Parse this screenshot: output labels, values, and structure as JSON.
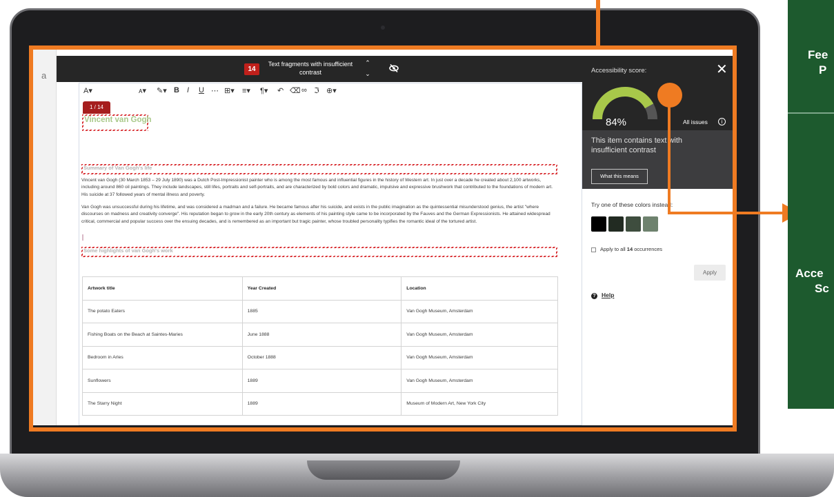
{
  "issue_bar": {
    "count": "14",
    "title": "Text fragments with insufficient contrast"
  },
  "editor": {
    "occurrence_tag": "1 / 14",
    "heading1": "Vincent van Gogh",
    "heading2": "Summary of Van Gogh's life",
    "para1": "Vincent van Gogh (30 March 1853 – 29 July 1890) was a Dutch Post-Impressionist painter who is among the most famous and influential figures in the history of Western art. In just over a decade he created about 2,100 artworks, including around 860 oil paintings. They include landscapes, still lifes, portraits and self-portraits, and are characterized by bold colors and dramatic, impulsive and expressive brushwork that contributed to the foundations of modern art. His suicide at 37 followed years of mental illness and poverty.",
    "para2": "Van Gogh was unsuccessful during his lifetime, and was considered a madman and a failure. He became famous after his suicide, and exists in the public imagination as the quintessential misunderstood genius, the artist \"where discourses on madness and creativity converge\". His reputation began to grow in the early 20th century as elements of his painting style came to be incorporated by the Fauves and the German Expressionists. He attained widespread critical, commercial and popular success over the ensuing decades, and is remembered as an important but tragic painter, whose troubled personality typifies the romantic ideal of the tortured artist.",
    "heading3": "Some highlights of van Gogh's work",
    "table": {
      "headers": [
        "Artwork title",
        "Year Created",
        "Location"
      ],
      "rows": [
        [
          "The potato Eaters",
          "1885",
          "Van Gogh Museum, Amsterdam"
        ],
        [
          "Fishing Boats on the Beach at Saintes-Maries",
          "June 1888",
          "Van Gogh Museum, Amsterdam"
        ],
        [
          "Bedroom in Arles",
          "October 1888",
          "Van Gogh Museum, Amsterdam"
        ],
        [
          "Sunflowers",
          "1889",
          "Van Gogh Museum, Amsterdam"
        ],
        [
          "The Starry Night",
          "1889",
          "Museum of Modern Art, New York City"
        ]
      ]
    }
  },
  "panel": {
    "score_label": "Accessibility score:",
    "score_value": "84%",
    "score_fraction": 0.84,
    "all_issues": "All issues",
    "message": "This item contains text with insufficient contrast",
    "what_button": "What this means",
    "try_label": "Try one of these colors instead:",
    "swatches": [
      "#000000",
      "#222b22",
      "#3e4d3e",
      "#6e826e"
    ],
    "apply_all_prefix": "Apply to all ",
    "apply_all_count": "14",
    "apply_all_suffix": " occurrences",
    "apply_button": "Apply",
    "help": "Help"
  },
  "callout": {
    "label_top": "Fee",
    "label_top2": "P",
    "label_bottom": "Acce",
    "label_bottom2": "Sc"
  },
  "colors": {
    "accent_orange": "#ef7b22",
    "callout_green": "#1d5a2e",
    "gauge_green": "#a8c84a",
    "issue_red": "#c0201b"
  }
}
